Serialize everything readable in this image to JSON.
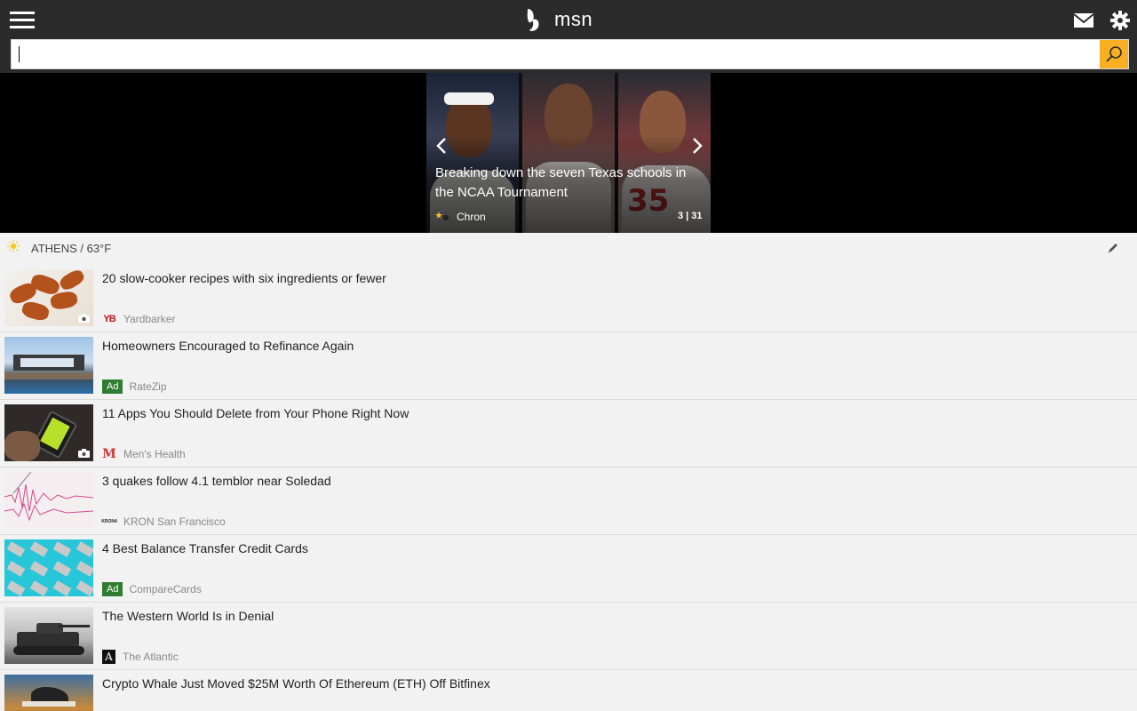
{
  "header": {
    "brand": "msn",
    "icons": {
      "menu": "hamburger-menu-icon",
      "logo": "msn-butterfly-icon",
      "mail": "mail-icon",
      "settings": "gear-icon"
    },
    "accent_color": "#f8b022"
  },
  "search": {
    "value": "",
    "placeholder": ""
  },
  "hero": {
    "title": "Breaking down the seven Texas schools in the NCAA Tournament",
    "source": "Chron",
    "counter": "3 | 31"
  },
  "weather": {
    "text": "ATHENS / 63°F",
    "icon": "sun-icon"
  },
  "feed": [
    {
      "headline": "20 slow-cooker recipes with six ingredients or fewer",
      "source": "Yardbarker",
      "logo_text": "YB",
      "ad": false,
      "ad_label": "",
      "camera": true
    },
    {
      "headline": "Homeowners Encouraged to Refinance Again",
      "source": "RateZip",
      "logo_text": "",
      "ad": true,
      "ad_label": "Ad",
      "camera": false
    },
    {
      "headline": "11 Apps You Should Delete from Your Phone Right Now",
      "source": "Men's Health",
      "logo_text": "M",
      "ad": false,
      "ad_label": "",
      "camera": true
    },
    {
      "headline": "3 quakes follow 4.1 temblor near Soledad",
      "source": "KRON San Francisco",
      "logo_text": "KRON4",
      "ad": false,
      "ad_label": "",
      "camera": false
    },
    {
      "headline": "4 Best Balance Transfer Credit Cards",
      "source": "CompareCards",
      "logo_text": "",
      "ad": true,
      "ad_label": "Ad",
      "camera": false
    },
    {
      "headline": "The Western World Is in Denial",
      "source": "The Atlantic",
      "logo_text": "A",
      "ad": false,
      "ad_label": "",
      "camera": false
    },
    {
      "headline": "Crypto Whale Just Moved $25M Worth Of Ethereum (ETH) Off Bitfinex",
      "source": "",
      "logo_text": "",
      "ad": false,
      "ad_label": "",
      "camera": false
    }
  ]
}
